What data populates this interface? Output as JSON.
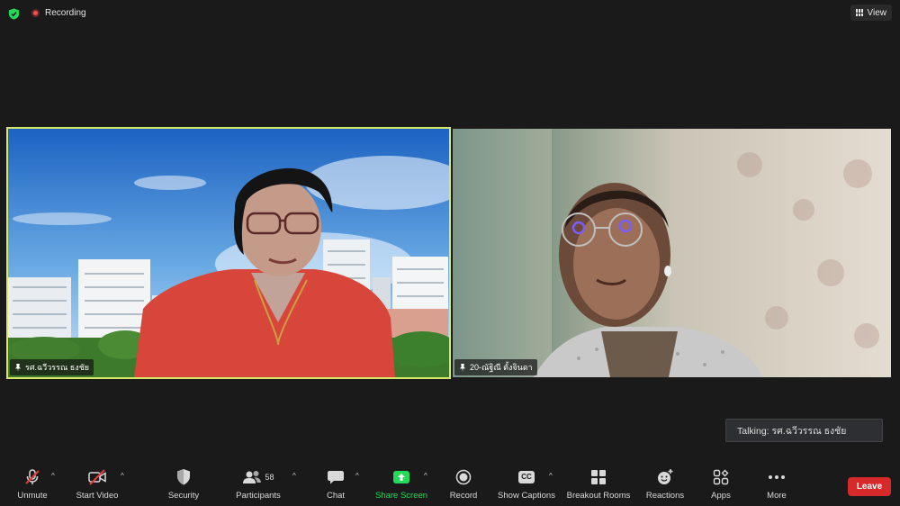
{
  "topbar": {
    "recording_label": "Recording",
    "view_label": "View",
    "shield_color": "#23d959",
    "record_color": "#f1504d"
  },
  "videos": [
    {
      "name": "รศ.ฉวีวรรณ  ธงชัย",
      "active_speaker": true,
      "border_color": "#d8e86a"
    },
    {
      "name": "20-ณัฐิณี ตั้งจินดา",
      "active_speaker": false
    }
  ],
  "talking_toast": {
    "text": "Talking: รศ.ฉวีวรรณ  ธงชัย"
  },
  "toolbar": {
    "unmute": "Unmute",
    "start_video": "Start Video",
    "security": "Security",
    "participants": "Participants",
    "participants_count": "58",
    "chat": "Chat",
    "share_screen": "Share Screen",
    "record": "Record",
    "show_captions": "Show Captions",
    "captions_icon_text": "CC",
    "breakout_rooms": "Breakout Rooms",
    "reactions": "Reactions",
    "apps": "Apps",
    "more": "More",
    "leave": "Leave",
    "leave_color": "#d62a2a",
    "share_color": "#23d959",
    "caret": "^"
  }
}
